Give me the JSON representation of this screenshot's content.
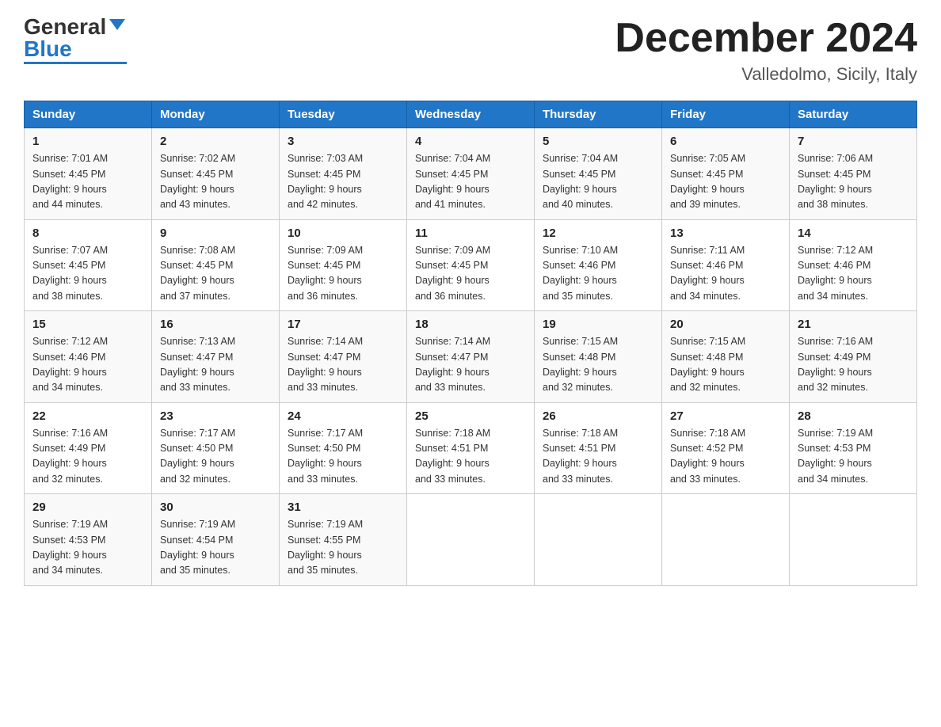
{
  "header": {
    "logo_general": "General",
    "logo_blue": "Blue",
    "title": "December 2024",
    "location": "Valledolmo, Sicily, Italy"
  },
  "days_of_week": [
    "Sunday",
    "Monday",
    "Tuesday",
    "Wednesday",
    "Thursday",
    "Friday",
    "Saturday"
  ],
  "weeks": [
    [
      {
        "day": "1",
        "sunrise": "7:01 AM",
        "sunset": "4:45 PM",
        "daylight": "9 hours and 44 minutes."
      },
      {
        "day": "2",
        "sunrise": "7:02 AM",
        "sunset": "4:45 PM",
        "daylight": "9 hours and 43 minutes."
      },
      {
        "day": "3",
        "sunrise": "7:03 AM",
        "sunset": "4:45 PM",
        "daylight": "9 hours and 42 minutes."
      },
      {
        "day": "4",
        "sunrise": "7:04 AM",
        "sunset": "4:45 PM",
        "daylight": "9 hours and 41 minutes."
      },
      {
        "day": "5",
        "sunrise": "7:04 AM",
        "sunset": "4:45 PM",
        "daylight": "9 hours and 40 minutes."
      },
      {
        "day": "6",
        "sunrise": "7:05 AM",
        "sunset": "4:45 PM",
        "daylight": "9 hours and 39 minutes."
      },
      {
        "day": "7",
        "sunrise": "7:06 AM",
        "sunset": "4:45 PM",
        "daylight": "9 hours and 38 minutes."
      }
    ],
    [
      {
        "day": "8",
        "sunrise": "7:07 AM",
        "sunset": "4:45 PM",
        "daylight": "9 hours and 38 minutes."
      },
      {
        "day": "9",
        "sunrise": "7:08 AM",
        "sunset": "4:45 PM",
        "daylight": "9 hours and 37 minutes."
      },
      {
        "day": "10",
        "sunrise": "7:09 AM",
        "sunset": "4:45 PM",
        "daylight": "9 hours and 36 minutes."
      },
      {
        "day": "11",
        "sunrise": "7:09 AM",
        "sunset": "4:45 PM",
        "daylight": "9 hours and 36 minutes."
      },
      {
        "day": "12",
        "sunrise": "7:10 AM",
        "sunset": "4:46 PM",
        "daylight": "9 hours and 35 minutes."
      },
      {
        "day": "13",
        "sunrise": "7:11 AM",
        "sunset": "4:46 PM",
        "daylight": "9 hours and 34 minutes."
      },
      {
        "day": "14",
        "sunrise": "7:12 AM",
        "sunset": "4:46 PM",
        "daylight": "9 hours and 34 minutes."
      }
    ],
    [
      {
        "day": "15",
        "sunrise": "7:12 AM",
        "sunset": "4:46 PM",
        "daylight": "9 hours and 34 minutes."
      },
      {
        "day": "16",
        "sunrise": "7:13 AM",
        "sunset": "4:47 PM",
        "daylight": "9 hours and 33 minutes."
      },
      {
        "day": "17",
        "sunrise": "7:14 AM",
        "sunset": "4:47 PM",
        "daylight": "9 hours and 33 minutes."
      },
      {
        "day": "18",
        "sunrise": "7:14 AM",
        "sunset": "4:47 PM",
        "daylight": "9 hours and 33 minutes."
      },
      {
        "day": "19",
        "sunrise": "7:15 AM",
        "sunset": "4:48 PM",
        "daylight": "9 hours and 32 minutes."
      },
      {
        "day": "20",
        "sunrise": "7:15 AM",
        "sunset": "4:48 PM",
        "daylight": "9 hours and 32 minutes."
      },
      {
        "day": "21",
        "sunrise": "7:16 AM",
        "sunset": "4:49 PM",
        "daylight": "9 hours and 32 minutes."
      }
    ],
    [
      {
        "day": "22",
        "sunrise": "7:16 AM",
        "sunset": "4:49 PM",
        "daylight": "9 hours and 32 minutes."
      },
      {
        "day": "23",
        "sunrise": "7:17 AM",
        "sunset": "4:50 PM",
        "daylight": "9 hours and 32 minutes."
      },
      {
        "day": "24",
        "sunrise": "7:17 AM",
        "sunset": "4:50 PM",
        "daylight": "9 hours and 33 minutes."
      },
      {
        "day": "25",
        "sunrise": "7:18 AM",
        "sunset": "4:51 PM",
        "daylight": "9 hours and 33 minutes."
      },
      {
        "day": "26",
        "sunrise": "7:18 AM",
        "sunset": "4:51 PM",
        "daylight": "9 hours and 33 minutes."
      },
      {
        "day": "27",
        "sunrise": "7:18 AM",
        "sunset": "4:52 PM",
        "daylight": "9 hours and 33 minutes."
      },
      {
        "day": "28",
        "sunrise": "7:19 AM",
        "sunset": "4:53 PM",
        "daylight": "9 hours and 34 minutes."
      }
    ],
    [
      {
        "day": "29",
        "sunrise": "7:19 AM",
        "sunset": "4:53 PM",
        "daylight": "9 hours and 34 minutes."
      },
      {
        "day": "30",
        "sunrise": "7:19 AM",
        "sunset": "4:54 PM",
        "daylight": "9 hours and 35 minutes."
      },
      {
        "day": "31",
        "sunrise": "7:19 AM",
        "sunset": "4:55 PM",
        "daylight": "9 hours and 35 minutes."
      },
      null,
      null,
      null,
      null
    ]
  ]
}
